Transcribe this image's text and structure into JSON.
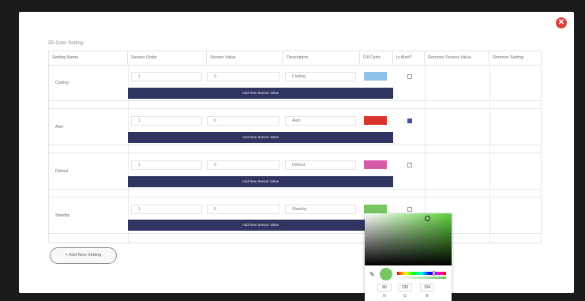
{
  "section_title": "2D Color Setting",
  "close_icon": "close-circle-icon",
  "headers": [
    "Setting Name",
    "Sensor Order",
    "Sensor Value",
    "Description",
    "Fill Color",
    "Is Alert?",
    "Remove Sensor Value",
    "Remove Setting"
  ],
  "rows": [
    {
      "name": "Cooling",
      "order": "1",
      "value": "0",
      "description": "Cooling",
      "color": "#8ec2ea",
      "alert": false
    },
    {
      "name": "Alert",
      "order": "1",
      "value": "0",
      "description": "Alert",
      "color": "#d9342b",
      "alert": true
    },
    {
      "name": "Defrost",
      "order": "1",
      "value": "0",
      "description": "Defrost",
      "color": "#d65aa7",
      "alert": false
    },
    {
      "name": "Standby",
      "order": "1",
      "value": "0",
      "description": "Standby",
      "color": "#76c764",
      "alert": false
    }
  ],
  "add_value_label": "Add New Sensor Value",
  "add_setting_label": "+ Add New Setting",
  "picker": {
    "r": "80",
    "g": "230",
    "b": "104",
    "r_label": "R",
    "g_label": "G",
    "b_label": "B",
    "preview_color": "#76c764"
  }
}
